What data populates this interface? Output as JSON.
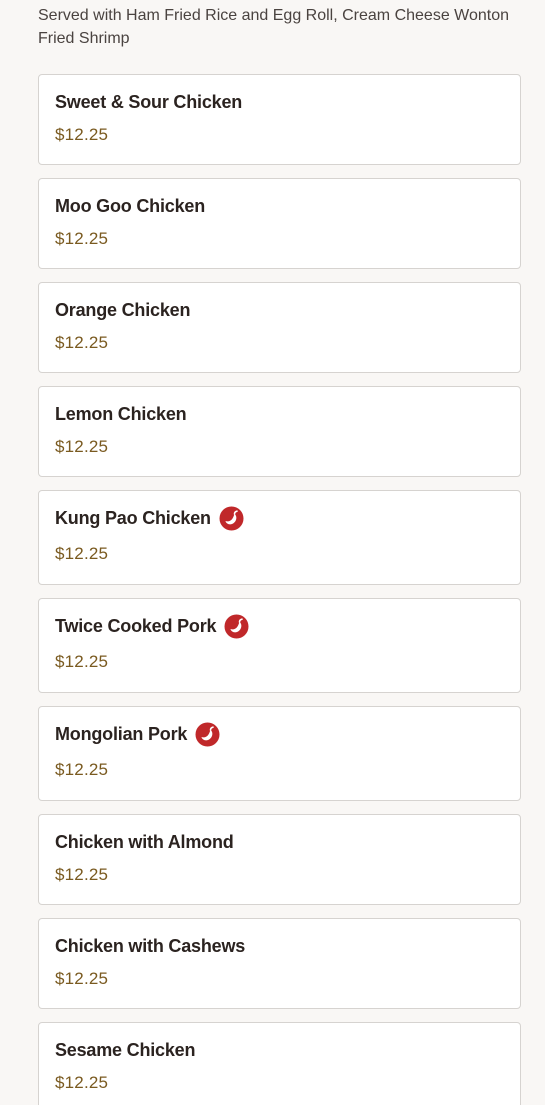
{
  "section": {
    "description": "Served with Ham Fried Rice and Egg Roll, Cream Cheese Wonton Fried Shrimp"
  },
  "items": [
    {
      "name": "Sweet & Sour Chicken",
      "price": "$12.25",
      "spicy": false
    },
    {
      "name": "Moo Goo Chicken",
      "price": "$12.25",
      "spicy": false
    },
    {
      "name": "Orange Chicken",
      "price": "$12.25",
      "spicy": false
    },
    {
      "name": "Lemon Chicken",
      "price": "$12.25",
      "spicy": false
    },
    {
      "name": "Kung Pao Chicken",
      "price": "$12.25",
      "spicy": true
    },
    {
      "name": "Twice Cooked Pork",
      "price": "$12.25",
      "spicy": true
    },
    {
      "name": "Mongolian Pork",
      "price": "$12.25",
      "spicy": true
    },
    {
      "name": "Chicken with Almond",
      "price": "$12.25",
      "spicy": false
    },
    {
      "name": "Chicken with Cashews",
      "price": "$12.25",
      "spicy": false
    },
    {
      "name": "Sesame Chicken",
      "price": "$12.25",
      "spicy": false
    }
  ],
  "icons": {
    "spicy": "chili-pepper-icon"
  },
  "colors": {
    "background": "#f9f7f5",
    "price": "#7a5a20",
    "spicy_badge": "#c0282a"
  }
}
